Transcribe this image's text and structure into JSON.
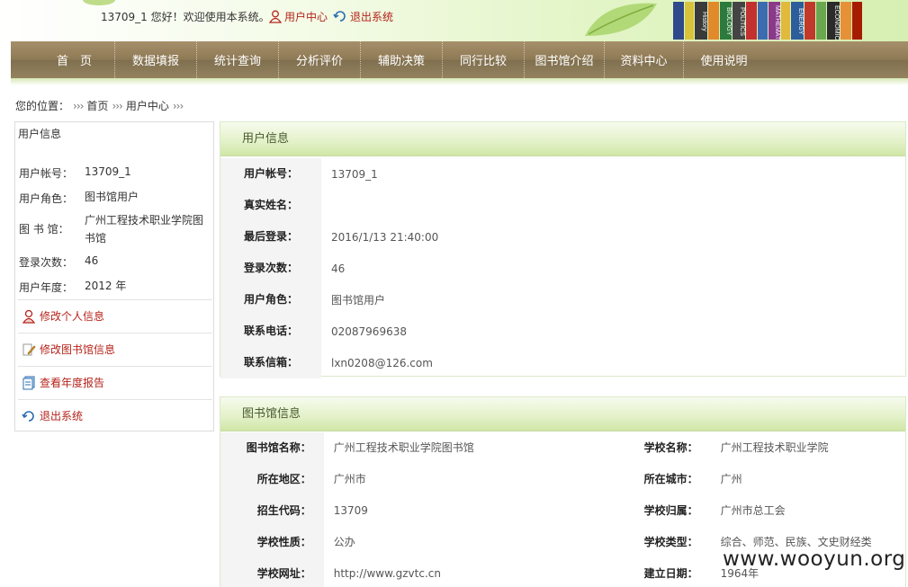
{
  "header": {
    "welcome_text": "13709_1 您好！欢迎使用本系统。",
    "user_center": "用户中心",
    "logout": "退出系统",
    "books": [
      {
        "label": "",
        "color": "#2f4a8a"
      },
      {
        "label": "",
        "color": "#d9c33a"
      },
      {
        "label": "History",
        "color": "#3a3a3a"
      },
      {
        "label": "",
        "color": "#e08a2a"
      },
      {
        "label": "BIOLOGY",
        "color": "#2d7a3d"
      },
      {
        "label": "POLITICS",
        "color": "#444444"
      },
      {
        "label": "",
        "color": "#c23030"
      },
      {
        "label": "",
        "color": "#3d6bb0"
      },
      {
        "label": "MATHEMATICS",
        "color": "#8a3a8a"
      },
      {
        "label": "",
        "color": "#e2b93b"
      },
      {
        "label": "ENERGY",
        "color": "#2d5d9a"
      },
      {
        "label": "",
        "color": "#c0392b"
      },
      {
        "label": "",
        "color": "#6aa84f"
      },
      {
        "label": "ECONOMICS",
        "color": "#2b2b2b"
      },
      {
        "label": "",
        "color": "#e69138"
      },
      {
        "label": "",
        "color": "#a61c00"
      }
    ]
  },
  "nav": {
    "items": [
      "首　页",
      "数据填报",
      "统计查询",
      "分析评价",
      "辅助决策",
      "同行比较",
      "图书馆介绍",
      "资料中心",
      "使用说明"
    ]
  },
  "breadcrumb": {
    "prefix": "您的位置：",
    "sep": "›››",
    "items": [
      "首页",
      "用户中心"
    ]
  },
  "left_panel": {
    "title": "用户信息",
    "rows": [
      {
        "key": "用户帐号：",
        "value": "13709_1"
      },
      {
        "key": "用户角色：",
        "value": "图书馆用户"
      },
      {
        "key": "图 书 馆：",
        "value": "广州工程技术职业学院图书馆"
      },
      {
        "key": "登录次数：",
        "value": "46"
      },
      {
        "key": "用户年度：",
        "value": "2012 年"
      }
    ],
    "menu": [
      "修改个人信息",
      "修改图书馆信息",
      "查看年度报告",
      "退出系统"
    ]
  },
  "user_info": {
    "title": "用户信息",
    "rows": [
      {
        "key": "用户帐号：",
        "value": "13709_1"
      },
      {
        "key": "真实姓名：",
        "value": ""
      },
      {
        "key": "最后登录：",
        "value": "2016/1/13 21:40:00"
      },
      {
        "key": "登录次数：",
        "value": "46"
      },
      {
        "key": "用户角色：",
        "value": "图书馆用户"
      },
      {
        "key": "联系电话：",
        "value": "02087969638"
      },
      {
        "key": "联系信箱：",
        "value": "lxn0208@126.com"
      }
    ]
  },
  "library_info": {
    "title": "图书馆信息",
    "rows": [
      {
        "k1": "图书馆名称：",
        "v1": "广州工程技术职业学院图书馆",
        "k2": "学校名称：",
        "v2": "广州工程技术职业学院"
      },
      {
        "k1": "所在地区：",
        "v1": "广州市",
        "k2": "所在城市：",
        "v2": "广州"
      },
      {
        "k1": "招生代码：",
        "v1": "13709",
        "k2": "学校归属：",
        "v2": "广州市总工会"
      },
      {
        "k1": "学校性质：",
        "v1": "公办",
        "k2": "学校类型：",
        "v2": "综合、师范、民族、文史财经类"
      },
      {
        "k1": "学校网址：",
        "v1": "http://www.gzvtc.cn",
        "k2": "建立日期：",
        "v2": "1964年"
      }
    ]
  },
  "watermark": "www.wooyun.org",
  "colors": {
    "nav": "#8f7a56",
    "link": "#b5231b",
    "panel_title": "#e3f1c8"
  }
}
